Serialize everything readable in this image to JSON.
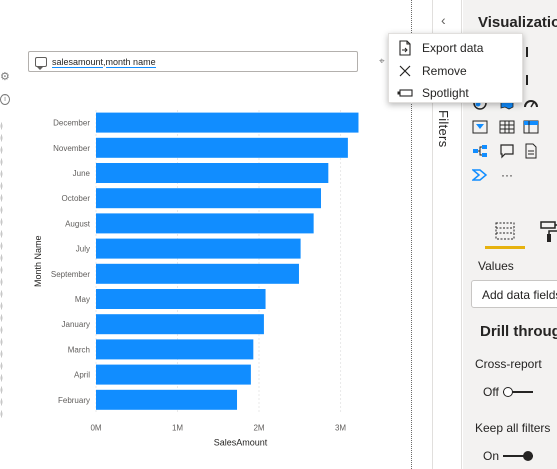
{
  "qa": {
    "query_part1": "salesamount",
    "query_sep": ",",
    "query_part2": "month name"
  },
  "context_menu": {
    "items": [
      {
        "label": "Export data",
        "icon": "export-icon"
      },
      {
        "label": "Remove",
        "icon": "close-icon"
      },
      {
        "label": "Spotlight",
        "icon": "spotlight-icon"
      }
    ]
  },
  "filters_pane": {
    "label": "Filters"
  },
  "viz_pane": {
    "title": "Visualizations",
    "values_label": "Values",
    "add_data_field": "Add data fields",
    "drill_through_title": "Drill through",
    "cross_report_label": "Cross-report",
    "cross_report_state": "Off",
    "keep_filters_label": "Keep all filters",
    "keep_filters_state": "On",
    "more_label": "···"
  },
  "colors": {
    "bar": "#118dff",
    "accent_tab": "#e6b20f",
    "toggle_off": "#ffffff",
    "toggle_on": "#252423"
  },
  "chart_data": {
    "type": "bar",
    "orientation": "horizontal",
    "xlabel": "SalesAmount",
    "ylabel": "Month Name",
    "xlim": [
      0,
      3300000
    ],
    "xticks": [
      {
        "value": 0,
        "label": "0M"
      },
      {
        "value": 1000000,
        "label": "1M"
      },
      {
        "value": 2000000,
        "label": "2M"
      },
      {
        "value": 3000000,
        "label": "3M"
      }
    ],
    "grid": true,
    "categories": [
      "December",
      "November",
      "June",
      "October",
      "August",
      "July",
      "September",
      "May",
      "January",
      "March",
      "April",
      "February"
    ],
    "values": [
      3220000,
      3090000,
      2850000,
      2760000,
      2670000,
      2510000,
      2490000,
      2080000,
      2060000,
      1930000,
      1900000,
      1730000
    ]
  }
}
